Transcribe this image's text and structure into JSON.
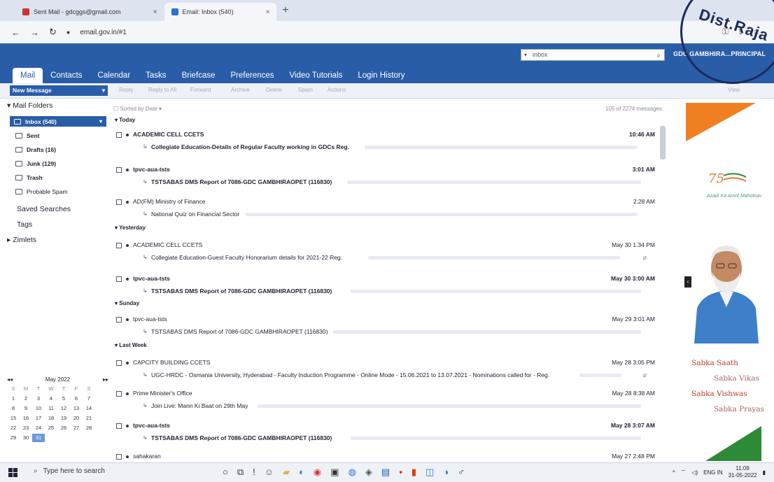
{
  "browser": {
    "tabs": [
      {
        "title": "Sent Mail - gdcggs@gmail.com",
        "active": false
      },
      {
        "title": "Email: Inbox (540)",
        "active": true
      }
    ],
    "close_glyph": "×",
    "new_tab_glyph": "+",
    "url": "email.gov.in/#1"
  },
  "header": {
    "search_placeholder": "inbox",
    "user": "GDC GAMBHIRA...PRINCIPAL"
  },
  "nav": {
    "tabs": [
      "Mail",
      "Contacts",
      "Calendar",
      "Tasks",
      "Briefcase",
      "Preferences",
      "Video Tutorials",
      "Login History"
    ],
    "active": "Mail"
  },
  "toolbar": {
    "new_message": "New Message",
    "items": [
      "Reply",
      "Reply to All",
      "Forward",
      "Archive",
      "Delete",
      "Spam",
      "Actions",
      "View"
    ]
  },
  "sidebar": {
    "mail_folders_label": "Mail Folders",
    "folders": [
      {
        "label": "Inbox (540)",
        "icon": "inbox-icon",
        "selected": true
      },
      {
        "label": "Sent",
        "icon": "sent-icon"
      },
      {
        "label": "Drafts (16)",
        "icon": "drafts-icon"
      },
      {
        "label": "Junk (129)",
        "icon": "junk-icon"
      },
      {
        "label": "Trash",
        "icon": "trash-icon"
      },
      {
        "label": "Probable Spam",
        "icon": "spam-icon"
      }
    ],
    "saved_searches": "Saved Searches",
    "tags": "Tags",
    "zimlets": "Zimlets"
  },
  "calendar": {
    "month": "May 2022",
    "dow": [
      "S",
      "M",
      "T",
      "W",
      "T",
      "F",
      "S"
    ],
    "days": [
      "1",
      "2",
      "3",
      "4",
      "5",
      "6",
      "7",
      "8",
      "9",
      "10",
      "11",
      "12",
      "13",
      "14",
      "15",
      "16",
      "17",
      "18",
      "19",
      "20",
      "21",
      "22",
      "23",
      "24",
      "25",
      "26",
      "27",
      "28",
      "29",
      "30",
      "31"
    ],
    "today": "31"
  },
  "list": {
    "sorted_by": "Sorted by Date",
    "count": "105 of 2274 messages",
    "groups": [
      {
        "label": "Today"
      },
      {
        "label": "Yesterday"
      },
      {
        "label": "Sunday"
      },
      {
        "label": "Last Week"
      }
    ],
    "messages": [
      {
        "sender": "ACADEMIC CELL CCETS",
        "subject": "Collegiate Education-Details of Regular Faculty working in GDCs Reg.",
        "time": "10:46 AM",
        "unread": true
      },
      {
        "sender": "tpvc-aua-tsts",
        "subject": "TSTSABAS DMS Report of 7086-GDC GAMBHIRAOPET (116830)",
        "time": "3:01 AM",
        "unread": true
      },
      {
        "sender": "AD(FM) Ministry of Finance",
        "subject": "National Quiz on Financial Sector",
        "time": "2:28 AM",
        "unread": false
      },
      {
        "sender": "ACADEMIC CELL CCETS",
        "subject": "Collegiate Education-Guest Faculty Honorarium details for 2021-22 Reg.",
        "time": "May 30 1:34 PM",
        "unread": false
      },
      {
        "sender": "tpvc-aua-tsts",
        "subject": "TSTSABAS DMS Report of 7086-GDC GAMBHIRAOPET (116830)",
        "time": "May 30 3:00 AM",
        "unread": true
      },
      {
        "sender": "tpvc-aua-tsts",
        "subject": "TSTSABAS DMS Report of 7086-GDC GAMBHIRAOPET (116830)",
        "time": "May 29 3:01 AM",
        "unread": false
      },
      {
        "sender": "CAPCITY BUILDING CCETS",
        "subject": "UGC-HRDC - Osmania University, Hyderabad - Faculty Induction Programme - Online Mode - 15.06.2021 to 13.07.2021 - Nominations called for - Reg.",
        "time": "May 28 3:05 PM",
        "unread": false
      },
      {
        "sender": "Prime Minister's Office",
        "subject": "Join Live: Mann Ki Baat on 29th May",
        "time": "May 28 8:38 AM",
        "unread": false
      },
      {
        "sender": "tpvc-aua-tsts",
        "subject": "TSTSABAS DMS Report of 7086-GDC GAMBHIRAOPET (116830)",
        "time": "May 28 3:07 AM",
        "unread": true
      },
      {
        "sender": "sahakaran",
        "subject": "",
        "time": "May 27 2:48 PM",
        "unread": false
      }
    ]
  },
  "banner": {
    "azadi": "Azadi Ka Amrit Mahotsav",
    "line1": "Sabka Saath",
    "line2": "Sabka Vikas",
    "line3": "Sabka Vishwas",
    "line4": "Sabka Prayas"
  },
  "seal": {
    "text": "Dist.Raja"
  },
  "taskbar": {
    "search_placeholder": "Type here to search",
    "lang": "ENG IN",
    "time": "11:09",
    "date": "31-05-2022"
  }
}
